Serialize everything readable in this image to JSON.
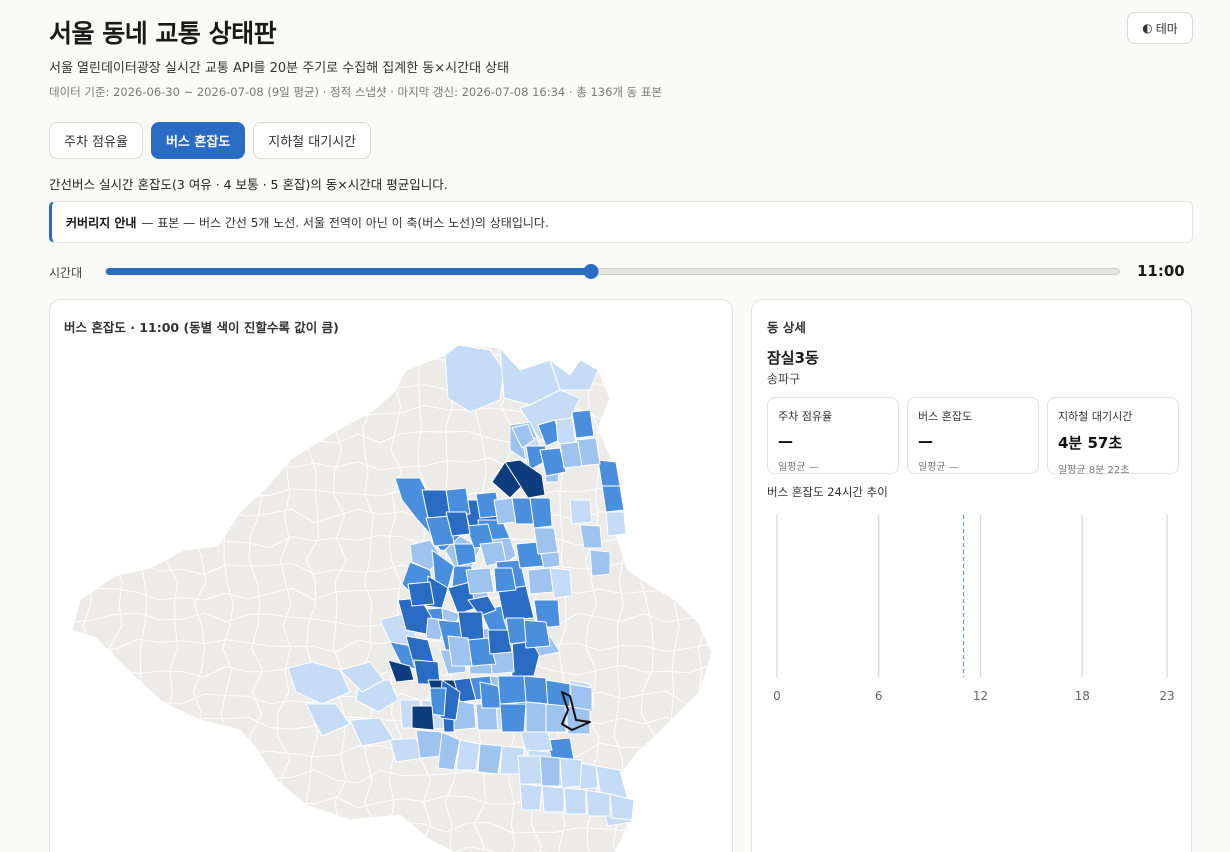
{
  "header": {
    "title": "서울 동네 교통 상태판",
    "theme_label": "테마",
    "theme_icon": "◐",
    "subtitle": "서울 열린데이터광장 실시간 교통 API를 20분 주기로 수집해 집계한 동×시간대 상태",
    "meta": "데이터 기준: 2026-06-30 ~ 2026-07-08 (9일 평균) · 정적 스냅샷 · 마지막 갱신: 2026-07-08 16:34 · 총 136개 동 표본"
  },
  "tabs": [
    {
      "label": "주차 점유율",
      "active": false
    },
    {
      "label": "버스 혼잡도",
      "active": true
    },
    {
      "label": "지하철 대기시간",
      "active": false
    }
  ],
  "description": "간선버스 실시간 혼잡도(3 여유 · 4 보통 · 5 혼잡)의 동×시간대 평균입니다.",
  "notice": {
    "title": "커버리지 안내",
    "text": "— 표본 — 버스 간선 5개 노선. 서울 전역이 아닌 이 축(버스 노선)의 상태입니다."
  },
  "slider": {
    "label": "시간대",
    "value_label": "11:00",
    "hour": 11,
    "min": 0,
    "max": 23
  },
  "map": {
    "title": "버스 혼잡도 · 11:00 (동별 색이 진할수록 값이 큼)",
    "colors": {
      "base": "#ecebe8",
      "stroke": "#ffffff",
      "c1": "#c6dcf6",
      "c2": "#9dc3ee",
      "c3": "#4a8fdd",
      "c4": "#2a6bc3",
      "c5": "#0d3d7f"
    }
  },
  "detail": {
    "heading": "동 상세",
    "dong": "잠실3동",
    "gu": "송파구",
    "cards": [
      {
        "label": "주차 점유율",
        "value": "—",
        "avg": "일평균 —"
      },
      {
        "label": "버스 혼잡도",
        "value": "—",
        "avg": "일평균 —"
      },
      {
        "label": "지하철 대기시간",
        "value": "4분 57초",
        "avg": "일평균 8분 22초"
      }
    ],
    "trend_title": "버스 혼잡도 24시간 추이",
    "trend_ticks": [
      "0",
      "6",
      "12",
      "18",
      "23"
    ],
    "current_hour": 11
  }
}
